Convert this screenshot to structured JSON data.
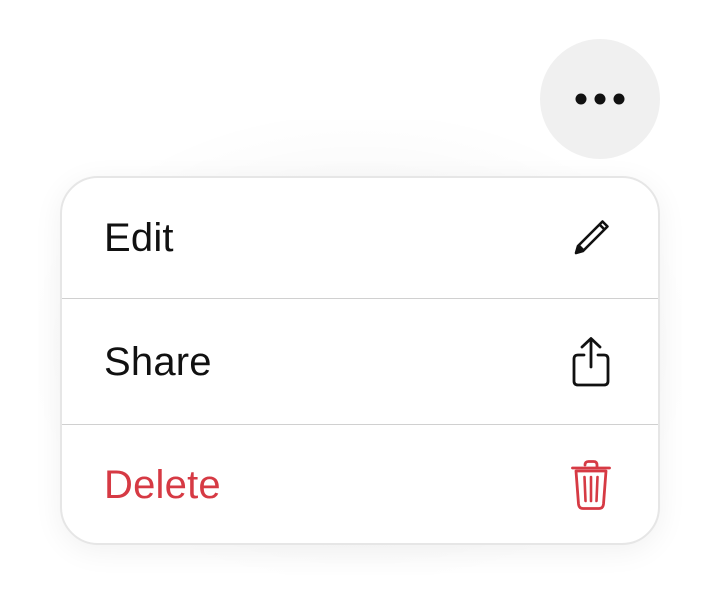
{
  "more_button": {
    "icon": "ellipsis-icon"
  },
  "menu": {
    "items": [
      {
        "label": "Edit",
        "icon": "pencil-icon",
        "color": "#111111"
      },
      {
        "label": "Share",
        "icon": "share-icon",
        "color": "#111111"
      },
      {
        "label": "Delete",
        "icon": "trash-icon",
        "color": "#d63a44"
      }
    ]
  },
  "colors": {
    "destructive": "#d63a44",
    "text": "#111111",
    "button_bg": "#f0f0f0",
    "divider": "#d0d0d0"
  }
}
